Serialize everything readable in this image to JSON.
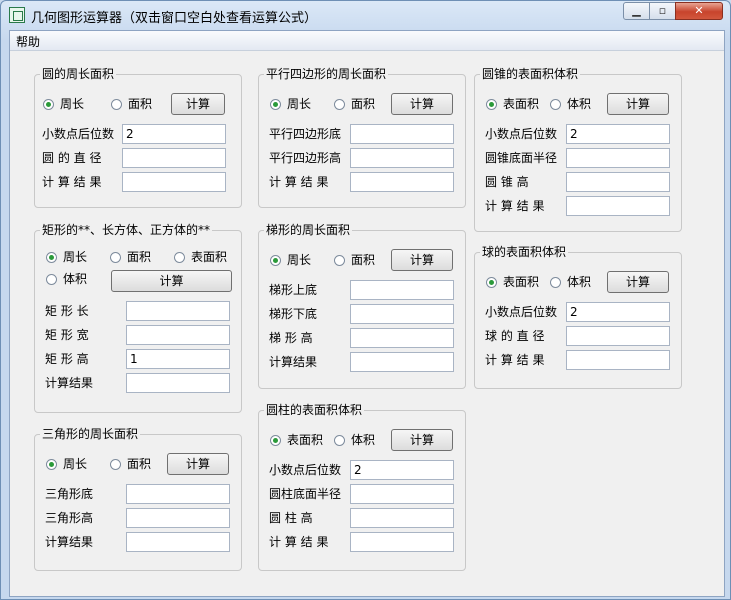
{
  "window": {
    "title": "几何图形运算器（双击窗口空白处查看运算公式）",
    "min_glyph": "▁",
    "max_glyph": "▫",
    "close_glyph": "✕"
  },
  "menu": {
    "help": "帮助"
  },
  "circle": {
    "title": "圆的周长面积",
    "radio_perimeter": "周长",
    "radio_area": "面积",
    "selected": "周长",
    "calc": "计算",
    "decimals_label": "小数点后位数",
    "decimals_value": "2",
    "diameter_label": "圆 的 直 径",
    "diameter_value": "",
    "result_label": "计 算 结 果",
    "result_value": ""
  },
  "parallelogram": {
    "title": "平行四边形的周长面积",
    "radio_perimeter": "周长",
    "radio_area": "面积",
    "selected": "周长",
    "calc": "计算",
    "base_label": "平行四边形底",
    "base_value": "",
    "height_label": "平行四边形高",
    "height_value": "",
    "result_label": "计 算 结 果",
    "result_value": ""
  },
  "cone": {
    "title": "圆锥的表面积体积",
    "radio_surface": "表面积",
    "radio_volume": "体积",
    "selected": "表面积",
    "calc": "计算",
    "decimals_label": "小数点后位数",
    "decimals_value": "2",
    "radius_label": "圆锥底面半径",
    "radius_value": "",
    "height_label": "圆 锥 高",
    "height_value": "",
    "result_label": "计 算 结 果",
    "result_value": ""
  },
  "rectangle": {
    "title": "矩形的**、长方体、正方体的**",
    "radio_perimeter": "周长",
    "radio_area": "面积",
    "radio_surface": "表面积",
    "radio_volume": "体积",
    "selected": "周长",
    "calc": "计算",
    "length_label": "矩 形 长",
    "length_value": "",
    "width_label": "矩 形 宽",
    "width_value": "",
    "height_label": "矩 形 高",
    "height_value": "1",
    "result_label": "计算结果",
    "result_value": ""
  },
  "trapezoid": {
    "title": "梯形的周长面积",
    "radio_perimeter": "周长",
    "radio_area": "面积",
    "selected": "周长",
    "calc": "计算",
    "top_label": "梯形上底",
    "top_value": "",
    "bottom_label": "梯形下底",
    "bottom_value": "",
    "height_label": "梯 形 高",
    "height_value": "",
    "result_label": "计算结果",
    "result_value": ""
  },
  "sphere": {
    "title": "球的表面积体积",
    "radio_surface": "表面积",
    "radio_volume": "体积",
    "selected": "表面积",
    "calc": "计算",
    "decimals_label": "小数点后位数",
    "decimals_value": "2",
    "diameter_label": "球 的 直 径",
    "diameter_value": "",
    "result_label": "计 算 结 果",
    "result_value": ""
  },
  "triangle": {
    "title": "三角形的周长面积",
    "radio_perimeter": "周长",
    "radio_area": "面积",
    "selected": "周长",
    "calc": "计算",
    "base_label": "三角形底",
    "base_value": "",
    "height_label": "三角形高",
    "height_value": "",
    "result_label": "计算结果",
    "result_value": ""
  },
  "cylinder": {
    "title": "圆柱的表面积体积",
    "radio_surface": "表面积",
    "radio_volume": "体积",
    "selected": "表面积",
    "calc": "计算",
    "decimals_label": "小数点后位数",
    "decimals_value": "2",
    "radius_label": "圆柱底面半径",
    "radius_value": "",
    "height_label": "圆 柱 高",
    "height_value": "",
    "result_label": "计 算 结 果",
    "result_value": ""
  }
}
